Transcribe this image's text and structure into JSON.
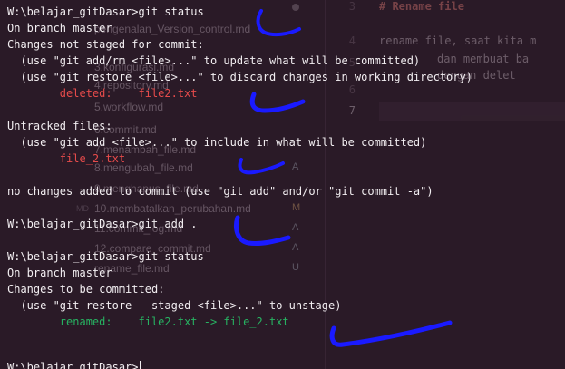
{
  "colors": {
    "background": "#2a1a27",
    "text": "#f2eef1",
    "deleted": "#e64b4b",
    "untracked": "#e64b4b",
    "renamed": "#27b362",
    "pen": "#1a1aff",
    "heading": "#e27a74"
  },
  "terminal": {
    "lines": [
      "W:\\belajar_gitDasar>git status",
      "On branch master",
      "Changes not staged for commit:",
      "  (use \"git add/rm <file>...\" to update what will be committed)",
      "  (use \"git restore <file>...\" to discard changes in working directory)",
      "        deleted:    file2.txt",
      "",
      "Untracked files:",
      "  (use \"git add <file>...\" to include in what will be committed)",
      "        file_2.txt",
      "",
      "no changes added to commit (use \"git add\" and/or \"git commit -a\")",
      "",
      "W:\\belajar_gitDasar>git add .",
      "",
      "W:\\belajar_gitDasar>git status",
      "On branch master",
      "Changes to be committed:",
      "  (use \"git restore --staged <file>...\" to unstage)",
      "        renamed:    file2.txt -> file_2.txt",
      "",
      "",
      "W:\\belajar_gitDasar>"
    ]
  },
  "editor": {
    "explorer_items": [
      {
        "name": "pengenalan_Version_control.md",
        "status": ""
      },
      {
        "name": "3.konfigurasi.md",
        "status": ""
      },
      {
        "name": "4.repository.md",
        "status": ""
      },
      {
        "name": "5.workflow.md",
        "status": ""
      },
      {
        "name": "6.commit.md",
        "status": ""
      },
      {
        "name": "7.menambah_file.md",
        "status": ""
      },
      {
        "name": "8.mengubah_file.md",
        "status": "A"
      },
      {
        "name": "9.menghapus_file.md",
        "status": ""
      },
      {
        "name": "10.membatalkan_perubahan.md",
        "status": "M"
      },
      {
        "name": "11.commit_log.md",
        "status": "A"
      },
      {
        "name": "12.compare_commit.md",
        "status": "A"
      },
      {
        "name": "rename_file.md",
        "status": "U"
      }
    ],
    "line_numbers": [
      "3",
      "4",
      "5",
      "6",
      "7"
    ],
    "code_lines": [
      "# Rename file",
      "rename file, saat kita m",
      "dan membuat ba",
      "dengan delet"
    ],
    "md_tag": "MD"
  }
}
